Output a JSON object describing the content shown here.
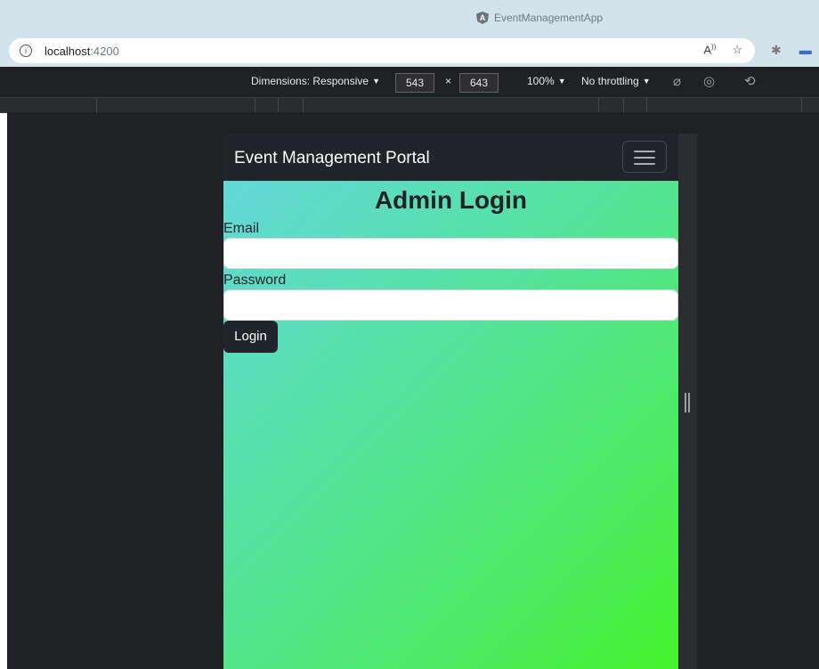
{
  "window": {
    "tab_title": "EventManagementApp",
    "tab_icon": "angular-icon"
  },
  "address_bar": {
    "host": "localhost",
    "port": ":4200"
  },
  "devtools": {
    "dimensions_label": "Dimensions: Responsive",
    "width": "543",
    "times": "×",
    "height": "643",
    "zoom": "100%",
    "throttling": "No throttling"
  },
  "app": {
    "brand": "Event Management Portal",
    "heading": "Admin Login",
    "email_label": "Email",
    "email_value": "",
    "password_label": "Password",
    "password_value": "",
    "login_button": "Login"
  },
  "colors": {
    "navbar": "#212529",
    "gradient_start": "#62d8da",
    "gradient_end": "#45f22a",
    "devtools_bg": "#202124"
  }
}
